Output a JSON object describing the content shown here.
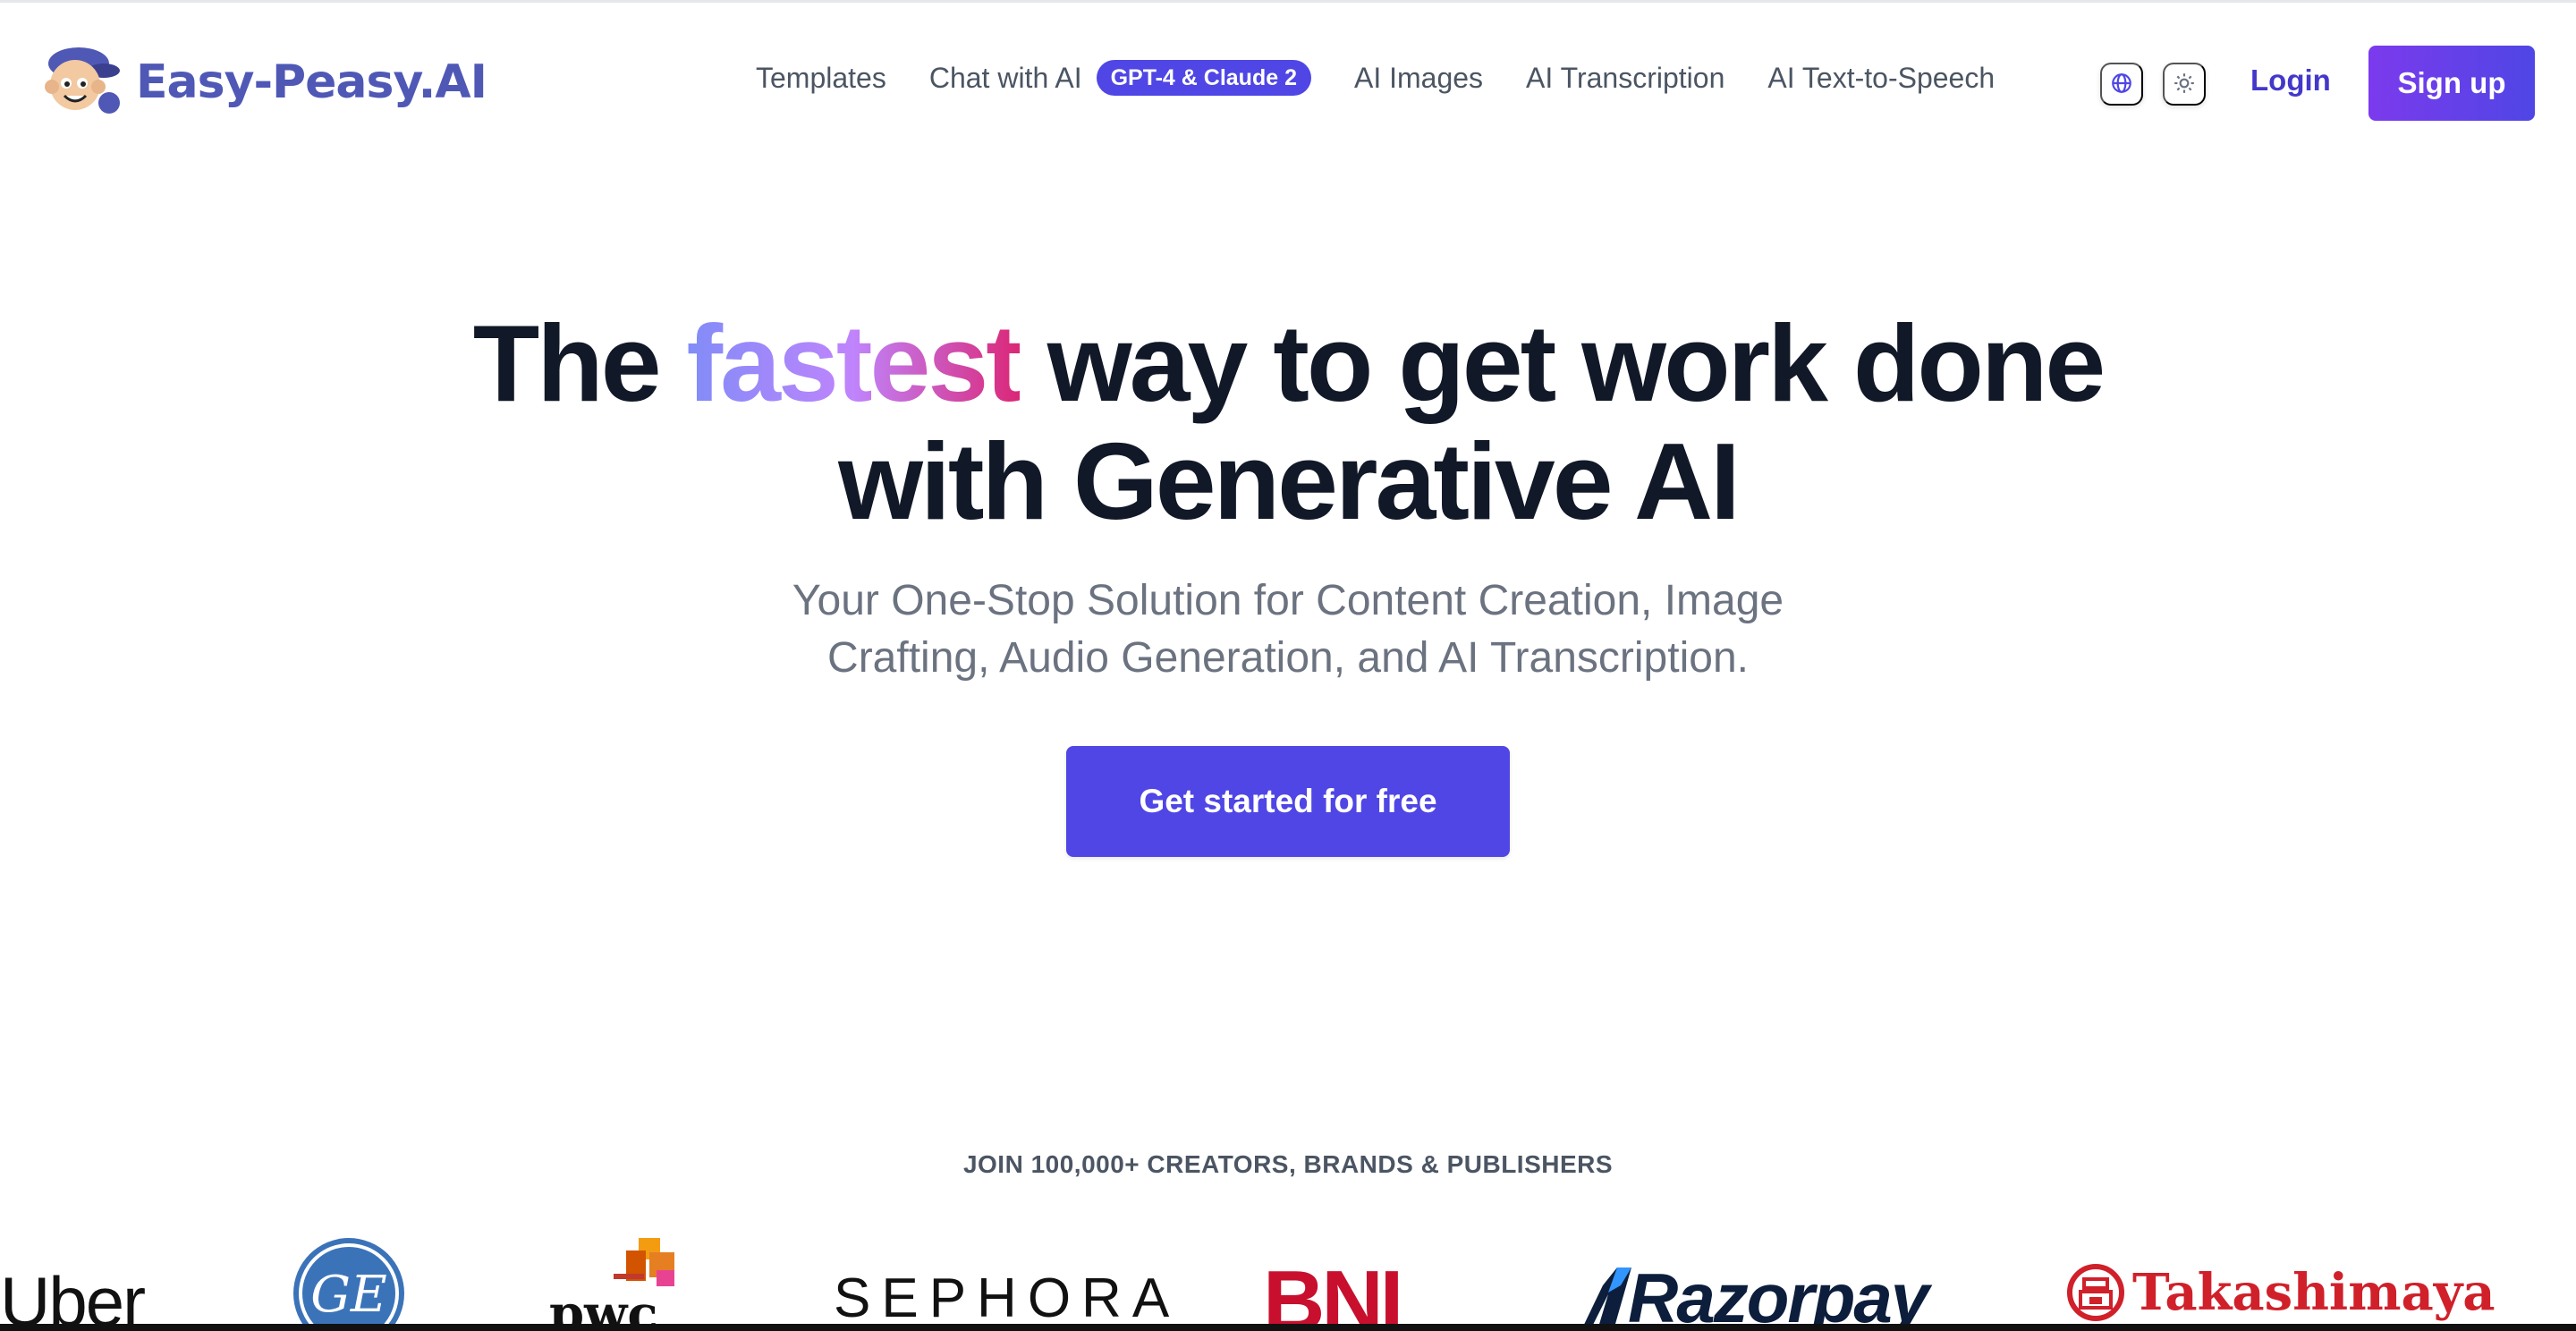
{
  "brand": {
    "name": "Easy-Peasy.AI"
  },
  "nav": {
    "items": [
      {
        "label": "Templates"
      },
      {
        "label": "Chat with AI",
        "badge": "GPT-4 & Claude 2"
      },
      {
        "label": "AI Images"
      },
      {
        "label": "AI Transcription"
      },
      {
        "label": "AI Text-to-Speech"
      }
    ],
    "language_icon": "globe-icon",
    "theme_icon": "sun-icon",
    "login_label": "Login",
    "signup_label": "Sign up"
  },
  "hero": {
    "title_before": "The ",
    "title_highlight": "fastest",
    "title_after": " way to get work done",
    "title_line2": "with Generative AI",
    "subtitle": "Your One-Stop Solution for Content Creation, Image Crafting, Audio Generation, and AI Transcription.",
    "cta_label": "Get started for free"
  },
  "social_proof": {
    "heading": "JOIN 100,000+ CREATORS, BRANDS & PUBLISHERS",
    "logos": [
      "Uber",
      "GE",
      "pwc",
      "SEPHORA",
      "BNI",
      "Razorpay",
      "Takashimaya"
    ]
  },
  "colors": {
    "accent": "#4f46e5",
    "brand_text": "#4f58b5",
    "signup_gradient_start": "#7c3aed",
    "highlight_gradient_end": "#db2777"
  }
}
